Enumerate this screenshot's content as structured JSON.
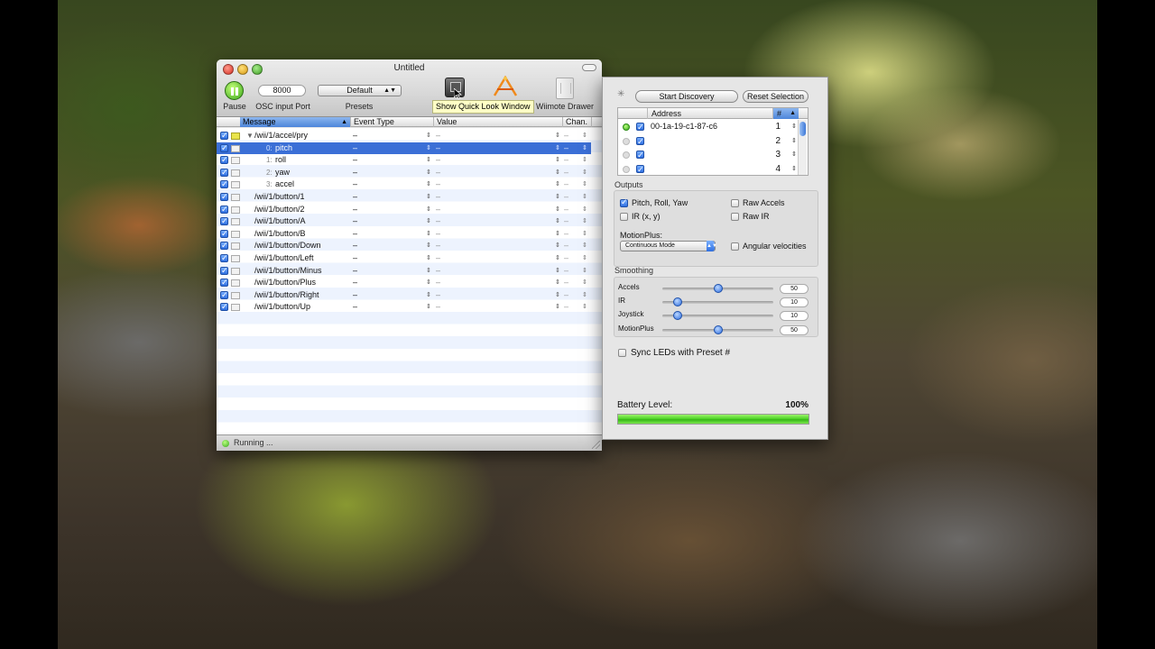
{
  "window": {
    "title": "Untitled",
    "toolbar": {
      "pause_label": "Pause",
      "port_value": "8000",
      "port_label": "OSC input Port",
      "preset_value": "Default",
      "preset_label": "Presets",
      "drawer_label": "Wiimote Drawer",
      "tooltip": "Show Quick Look Window"
    },
    "table": {
      "headers": {
        "message": "Message",
        "event_type": "Event Type",
        "value": "Value",
        "channel": "Chan."
      },
      "rows": [
        {
          "message": "/wii/1/accel/pry",
          "index": "",
          "event": "–",
          "value": "–",
          "chan": "–",
          "selected": false,
          "group": true
        },
        {
          "message": "pitch",
          "index": "0:",
          "event": "–",
          "value": "–",
          "chan": "–",
          "selected": true
        },
        {
          "message": "roll",
          "index": "1:",
          "event": "–",
          "value": "–",
          "chan": "–",
          "selected": false
        },
        {
          "message": "yaw",
          "index": "2:",
          "event": "–",
          "value": "–",
          "chan": "–",
          "selected": false
        },
        {
          "message": "accel",
          "index": "3:",
          "event": "–",
          "value": "–",
          "chan": "–",
          "selected": false
        },
        {
          "message": "/wii/1/button/1",
          "index": "",
          "event": "–",
          "value": "–",
          "chan": "–",
          "selected": false
        },
        {
          "message": "/wii/1/button/2",
          "index": "",
          "event": "–",
          "value": "–",
          "chan": "–",
          "selected": false
        },
        {
          "message": "/wii/1/button/A",
          "index": "",
          "event": "–",
          "value": "–",
          "chan": "–",
          "selected": false
        },
        {
          "message": "/wii/1/button/B",
          "index": "",
          "event": "–",
          "value": "–",
          "chan": "–",
          "selected": false
        },
        {
          "message": "/wii/1/button/Down",
          "index": "",
          "event": "–",
          "value": "–",
          "chan": "–",
          "selected": false
        },
        {
          "message": "/wii/1/button/Left",
          "index": "",
          "event": "–",
          "value": "–",
          "chan": "–",
          "selected": false
        },
        {
          "message": "/wii/1/button/Minus",
          "index": "",
          "event": "–",
          "value": "–",
          "chan": "–",
          "selected": false
        },
        {
          "message": "/wii/1/button/Plus",
          "index": "",
          "event": "–",
          "value": "–",
          "chan": "–",
          "selected": false
        },
        {
          "message": "/wii/1/button/Right",
          "index": "",
          "event": "–",
          "value": "–",
          "chan": "–",
          "selected": false
        },
        {
          "message": "/wii/1/button/Up",
          "index": "",
          "event": "–",
          "value": "–",
          "chan": "–",
          "selected": false
        }
      ]
    },
    "status": "Running ..."
  },
  "drawer": {
    "start_discovery": "Start Discovery",
    "reset_selection": "Reset Selection",
    "devices": {
      "headers": {
        "address": "Address",
        "number": "#"
      },
      "rows": [
        {
          "address": "00-1a-19-c1-87-c6",
          "number": "1",
          "connected": true
        },
        {
          "address": "",
          "number": "2",
          "connected": false
        },
        {
          "address": "",
          "number": "3",
          "connected": false
        },
        {
          "address": "",
          "number": "4",
          "connected": false
        }
      ]
    },
    "outputs": {
      "title": "Outputs",
      "pitch_roll_yaw": "Pitch, Roll, Yaw",
      "raw_accels": "Raw Accels",
      "ir_xy": "IR (x, y)",
      "raw_ir": "Raw IR",
      "motionplus_label": "MotionPlus:",
      "motionplus_mode": "Continuous Mode",
      "angular_velocities": "Angular velocities"
    },
    "smoothing": {
      "title": "Smoothing",
      "sliders": [
        {
          "label": "Accels",
          "value": "50",
          "fraction": 0.5
        },
        {
          "label": "IR",
          "value": "10",
          "fraction": 0.14
        },
        {
          "label": "Joystick",
          "value": "10",
          "fraction": 0.14
        },
        {
          "label": "MotionPlus",
          "value": "50",
          "fraction": 0.5
        }
      ]
    },
    "sync_leds": "Sync LEDs with Preset #",
    "battery": {
      "label": "Battery Level:",
      "percent": "100%",
      "fraction": 1.0
    }
  },
  "colors": {
    "selection": "#3b6fd6",
    "accent_green": "#34a51b",
    "tooltip_bg": "#ffffc6"
  }
}
